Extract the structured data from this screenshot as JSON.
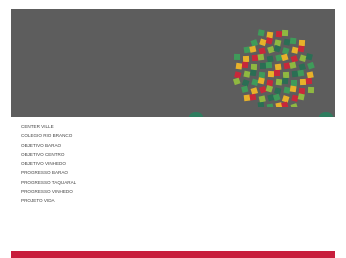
{
  "schools": [
    "CENTER VILLE",
    "COLEGIO RIO BRANCO",
    "OBJETIVO BARAO",
    "OBJETIVO CENTRO",
    "OBJETIVO VINHEDO",
    "PROGRESSO BARAO",
    "PROGRESSO TAQUARAL",
    "PROGRESSO VINHEDO",
    "PROJETO VIDA"
  ],
  "colors": {
    "header_bg": "#5d5d5d",
    "footer": "#c81d3c",
    "mosaic": [
      "#c8283a",
      "#e8b12a",
      "#3f9b5a",
      "#2b6e54",
      "#8fb841"
    ]
  },
  "icons": {
    "logo": "mosaic-sphere-logo"
  }
}
